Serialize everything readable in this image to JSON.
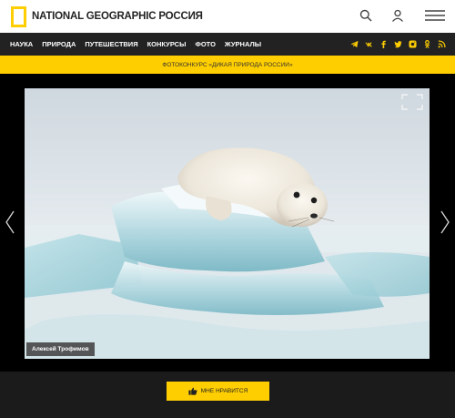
{
  "header": {
    "logo_text": "NATIONAL GEOGRAPHIC РОССИЯ",
    "icons": [
      "search-icon",
      "user-icon",
      "menu-icon"
    ]
  },
  "nav": {
    "items": [
      "НАУКА",
      "ПРИРОДА",
      "ПУТЕШЕСТВИЯ",
      "КОНКУРСЫ",
      "ФОТО",
      "ЖУРНАЛЫ"
    ],
    "social_icons": [
      "telegram-icon",
      "vk-icon",
      "facebook-icon",
      "twitter-icon",
      "instagram-icon",
      "odnoklassniki-icon",
      "rss-icon"
    ]
  },
  "banner": {
    "text": "ФОТОКОНКУРС «ДИКАЯ ПРИРОДА РОССИИ»"
  },
  "gallery": {
    "photo_credit": "Алексей Трофимов",
    "nav_icons": [
      "chevron-left-icon",
      "chevron-right-icon",
      "fullscreen-icon"
    ]
  },
  "actions": {
    "like_label": "МНЕ НРАВИТСЯ"
  },
  "colors": {
    "accent": "#ffce00",
    "nav_bg": "#222222",
    "page_bg": "#1b1b1b"
  }
}
